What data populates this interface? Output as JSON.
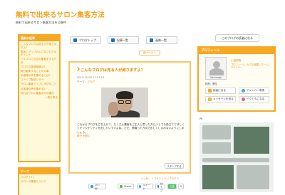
{
  "header": {
    "title": "無料で出来るサロン集客方法",
    "subtitle": "無料で出来るサロン集客方法を公開中"
  },
  "nav": {
    "items": [
      {
        "label": "ブログトップ"
      },
      {
        "label": "記事一覧"
      },
      {
        "label": "画像一覧"
      }
    ],
    "reader_button": "このブログの読者になる"
  },
  "left_sidebar": {
    "recent": {
      "heading": "最新の記事",
      "items": [
        "こんなブログは見る人が減りますよ？",
        "集客力アップの小さなブログのポイント",
        "アメブロでお店の集客をする方法",
        "ブログの更新頻度は？",
        "毎日更新することが大事",
        "お客様の声を集めるには？",
        "ステップ配信とSEO",
        "サロン集客アップに大切なこと",
        "お客様の声を集める2",
        "売れるサロン集客法の共通点"
      ],
      "more": "一覧を見る"
    },
    "theme": {
      "heading": "テーマ",
      "items": [
        "ブログ ( 1 )",
        "サロンの集客について"
      ]
    }
  },
  "main": {
    "prev_label": "前ページへ",
    "post": {
      "title": "こんなブログは見る人が減りますよ？",
      "date": "2013-12-09 21:11:13",
      "theme_label": "テーマ：",
      "theme": "ブログ",
      "body": "これからブログを立ち上げて、たくさん集客をご主人と思った方に少しでも役立ててほしくてオリジナリティを出したいですよね。ただ、間違った方向で出してしまわないようにしましょう。",
      "read_more": "続きを読む",
      "stamp": "スタンプする",
      "meta": "いいね！ 1  コメント 0  リブログ 0"
    },
    "share": [
      "いいね！",
      "Check",
      "ツイート",
      "はてブ",
      "LINEで送る",
      "0"
    ]
  },
  "right_sidebar": {
    "profile_heading": "プロフィール",
    "avatar_text": "No Image",
    "name": "小田部裕",
    "links": [
      "プロフィール",
      "ピグの部屋",
      "ホーム",
      "アメンバー"
    ],
    "sex": "性別：男性",
    "buttons": [
      "読者になる",
      "アメンバー申請",
      "メッセージを送る",
      "ピグともになる"
    ],
    "ads_label": "PR"
  },
  "colors": {
    "accent": "#f7a823",
    "title": "#f4a11a",
    "link": "#e08a00"
  }
}
